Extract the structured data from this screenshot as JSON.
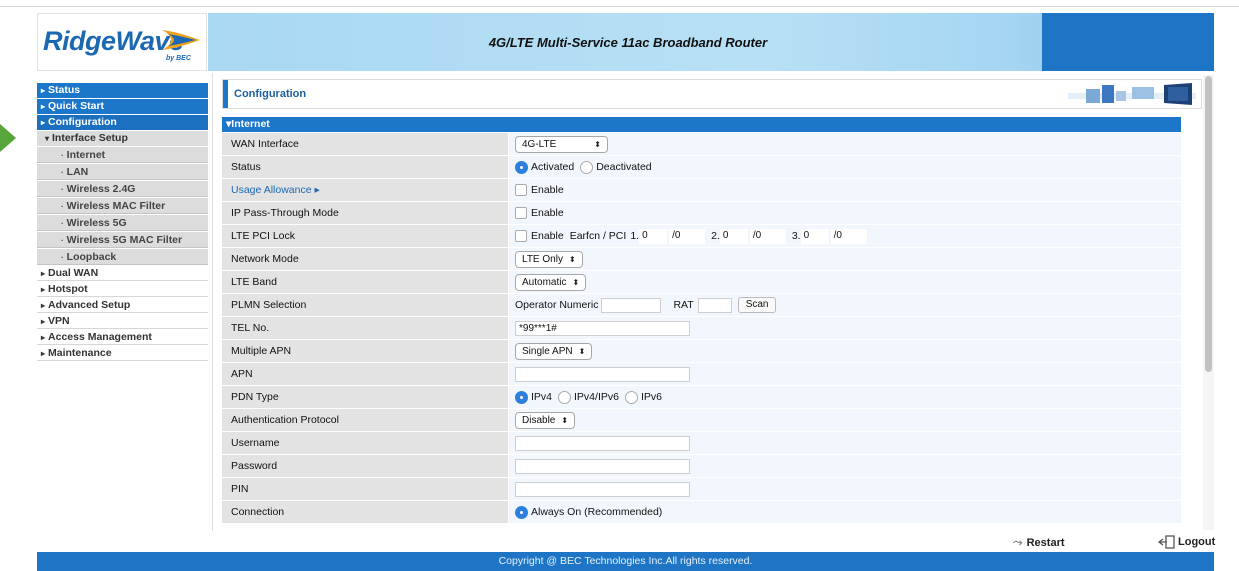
{
  "brand": {
    "name": "RidgeWave",
    "sub": "by BEC"
  },
  "header": {
    "title": "4G/LTE Multi-Service 11ac Broadband Router"
  },
  "sidebar": {
    "items": [
      {
        "label": "Status"
      },
      {
        "label": "Quick Start"
      },
      {
        "label": "Configuration"
      },
      {
        "label": "Interface Setup"
      },
      {
        "label": "Internet"
      },
      {
        "label": "LAN"
      },
      {
        "label": "Wireless 2.4G"
      },
      {
        "label": "Wireless MAC Filter"
      },
      {
        "label": "Wireless 5G"
      },
      {
        "label": "Wireless 5G MAC Filter"
      },
      {
        "label": "Loopback"
      },
      {
        "label": "Dual WAN"
      },
      {
        "label": "Hotspot"
      },
      {
        "label": "Advanced Setup"
      },
      {
        "label": "VPN"
      },
      {
        "label": "Access Management"
      },
      {
        "label": "Maintenance"
      }
    ]
  },
  "main": {
    "title": "Configuration",
    "section": "Internet",
    "wan_interface": {
      "label": "WAN Interface",
      "value": "4G-LTE"
    },
    "status": {
      "label": "Status",
      "opt1": "Activated",
      "opt2": "Deactivated"
    },
    "usage": {
      "label": "Usage Allowance",
      "enable": "Enable"
    },
    "ip_pass": {
      "label": "IP Pass-Through Mode",
      "enable": "Enable"
    },
    "pci_lock": {
      "label": "LTE PCI Lock",
      "enable": "Enable",
      "earfcn_label": "Earfcn / PCI",
      "n1": "1.",
      "v1a": "0",
      "v1b": "0",
      "n2": "2.",
      "v2a": "0",
      "v2b": "0",
      "n3": "3.",
      "v3a": "0",
      "v3b": "0"
    },
    "network_mode": {
      "label": "Network Mode",
      "value": "LTE Only"
    },
    "lte_band": {
      "label": "LTE Band",
      "value": "Automatic"
    },
    "plmn": {
      "label": "PLMN Selection",
      "operator": "Operator Numeric",
      "rat": "RAT",
      "scan": "Scan"
    },
    "tel": {
      "label": "TEL No.",
      "value": "*99***1#"
    },
    "multiple_apn": {
      "label": "Multiple APN",
      "value": "Single APN"
    },
    "apn": {
      "label": "APN",
      "value": ""
    },
    "pdn": {
      "label": "PDN Type",
      "opt1": "IPv4",
      "opt2": "IPv4/IPv6",
      "opt3": "IPv6"
    },
    "auth": {
      "label": "Authentication Protocol",
      "value": "Disable"
    },
    "username": {
      "label": "Username",
      "value": ""
    },
    "password": {
      "label": "Password",
      "value": ""
    },
    "pin": {
      "label": "PIN",
      "value": ""
    },
    "connection": {
      "label": "Connection",
      "opt1": "Always On (Recommended)"
    }
  },
  "actions": {
    "restart": "Restart",
    "logout": "Logout"
  },
  "footer": {
    "copyright": "Copyright @ BEC Technologies Inc.All rights reserved."
  },
  "colors": {
    "accent": "#1c76c9",
    "header_light": "#a9d8f3",
    "pointer": "#58a63b"
  }
}
